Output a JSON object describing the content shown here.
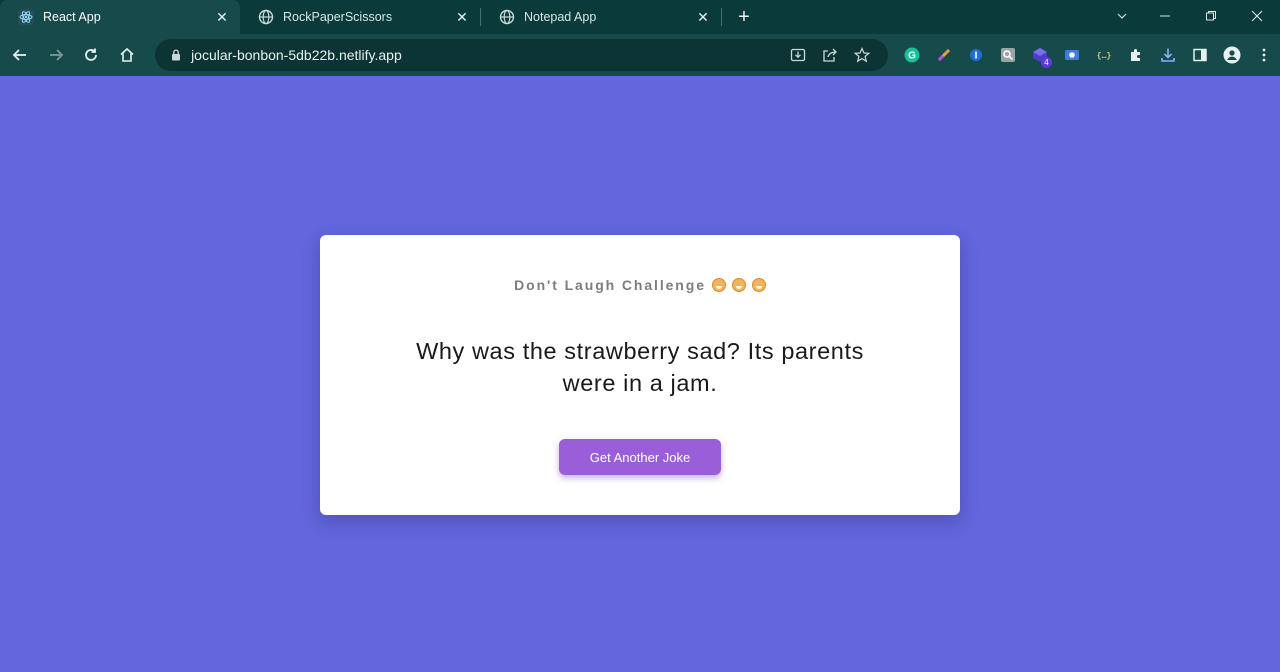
{
  "browser": {
    "tabs": [
      {
        "title": "React App",
        "active": true,
        "favicon": "react-atom-icon"
      },
      {
        "title": "RockPaperScissors",
        "active": false,
        "favicon": "globe-icon"
      },
      {
        "title": "Notepad App",
        "active": false,
        "favicon": "globe-icon"
      }
    ],
    "new_tab_label": "+",
    "address": "jocular-bonbon-5db22b.netlify.app",
    "extension_badge": "4",
    "colors": {
      "frame": "#0b3a3a",
      "toolbar": "#174a4a",
      "omnibox": "#0d3434"
    }
  },
  "page": {
    "background": "#6366dc",
    "card": {
      "title": "Don't Laugh Challenge",
      "title_emoji_count": 3,
      "joke": "Why was the strawberry sad? Its parents were in a jam.",
      "button_label": "Get Another Joke",
      "button_color": "#9b5ed9"
    }
  }
}
